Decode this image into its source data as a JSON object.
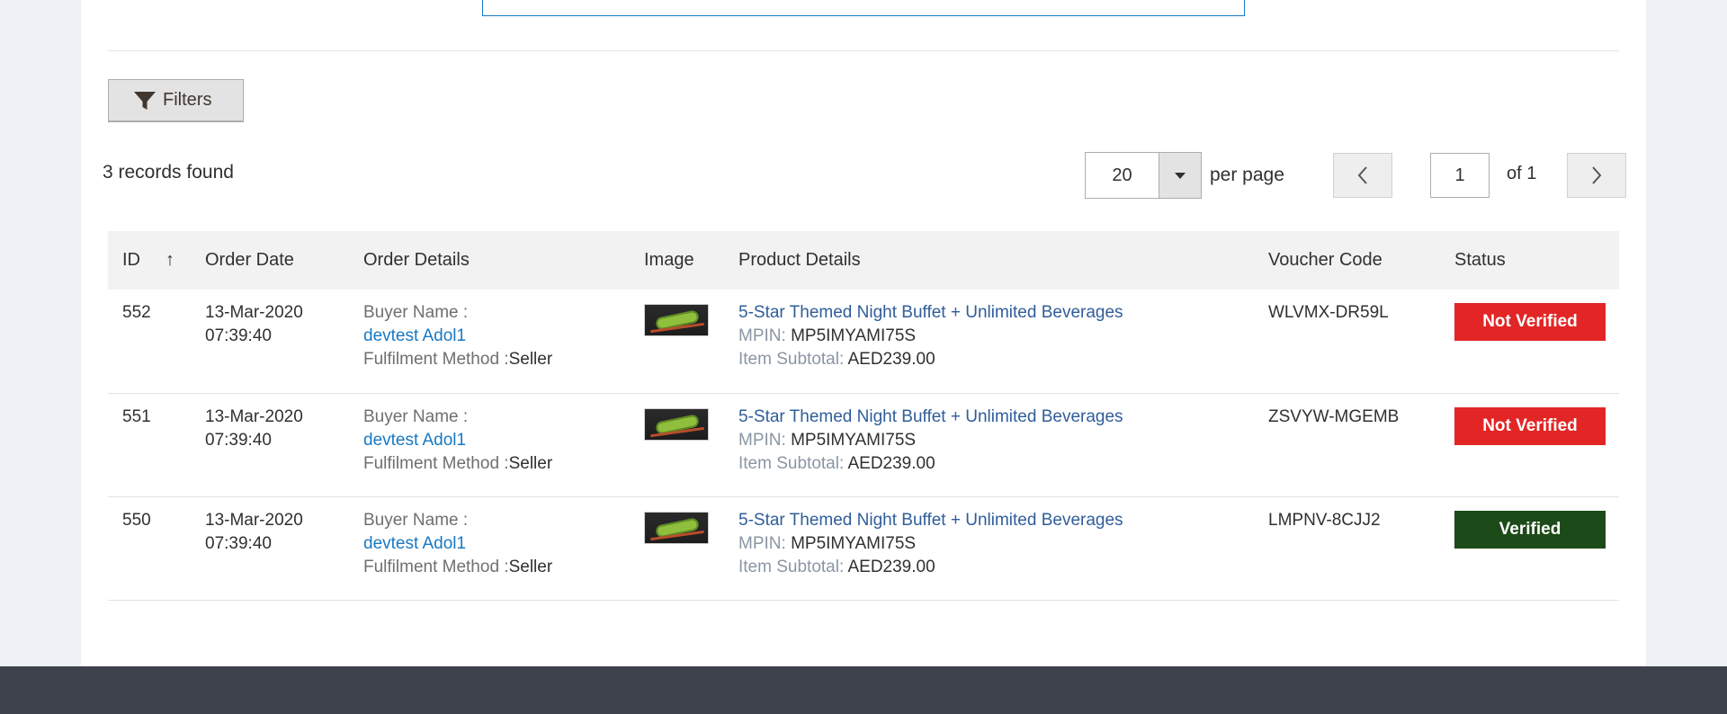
{
  "toolbar": {
    "filters_label": "Filters",
    "records_found": "3 records found",
    "per_page_value": "20",
    "per_page_label": "per page",
    "current_page": "1",
    "of_total": "of 1"
  },
  "table": {
    "headers": {
      "id": "ID",
      "order_date": "Order Date",
      "order_details": "Order Details",
      "image": "Image",
      "product_details": "Product Details",
      "voucher_code": "Voucher Code",
      "status": "Status"
    },
    "sort_indicator": "↑",
    "rows": [
      {
        "id": "552",
        "date": "13-Mar-2020",
        "time": "07:39:40",
        "buyer_label": "Buyer Name :",
        "buyer_name": "devtest Adol1",
        "fulfilment_label": "Fulfilment Method :",
        "fulfilment_value": "Seller",
        "product_name": "5-Star Themed Night Buffet + Unlimited Beverages",
        "mpin_label": "MPIN:",
        "mpin_value": "MP5IMYAMI75S",
        "subtotal_label": "Item Subtotal:",
        "subtotal_value": "AED239.00",
        "voucher": "WLVMX-DR59L",
        "status": "Not Verified",
        "status_color": "#e22626"
      },
      {
        "id": "551",
        "date": "13-Mar-2020",
        "time": "07:39:40",
        "buyer_label": "Buyer Name :",
        "buyer_name": "devtest Adol1",
        "fulfilment_label": "Fulfilment Method :",
        "fulfilment_value": "Seller",
        "product_name": "5-Star Themed Night Buffet + Unlimited Beverages",
        "mpin_label": "MPIN:",
        "mpin_value": "MP5IMYAMI75S",
        "subtotal_label": "Item Subtotal:",
        "subtotal_value": "AED239.00",
        "voucher": "ZSVYW-MGEMB",
        "status": "Not Verified",
        "status_color": "#e22626"
      },
      {
        "id": "550",
        "date": "13-Mar-2020",
        "time": "07:39:40",
        "buyer_label": "Buyer Name :",
        "buyer_name": "devtest Adol1",
        "fulfilment_label": "Fulfilment Method :",
        "fulfilment_value": "Seller",
        "product_name": "5-Star Themed Night Buffet + Unlimited Beverages",
        "mpin_label": "MPIN:",
        "mpin_value": "MP5IMYAMI75S",
        "subtotal_label": "Item Subtotal:",
        "subtotal_value": "AED239.00",
        "voucher": "LMPNV-8CJJ2",
        "status": "Verified",
        "status_color": "#1c4a18"
      }
    ]
  },
  "colors": {
    "link": "#1979c3",
    "product_link": "#2f5d9a",
    "footer": "#3d424c",
    "not_verified": "#e22626",
    "verified": "#1c4a18"
  },
  "icons": {
    "filters": "funnel-icon",
    "prev": "chevron-left-icon",
    "next": "chevron-right-icon",
    "dropdown": "caret-down-icon",
    "thumbnail": "product-thumbnail"
  }
}
